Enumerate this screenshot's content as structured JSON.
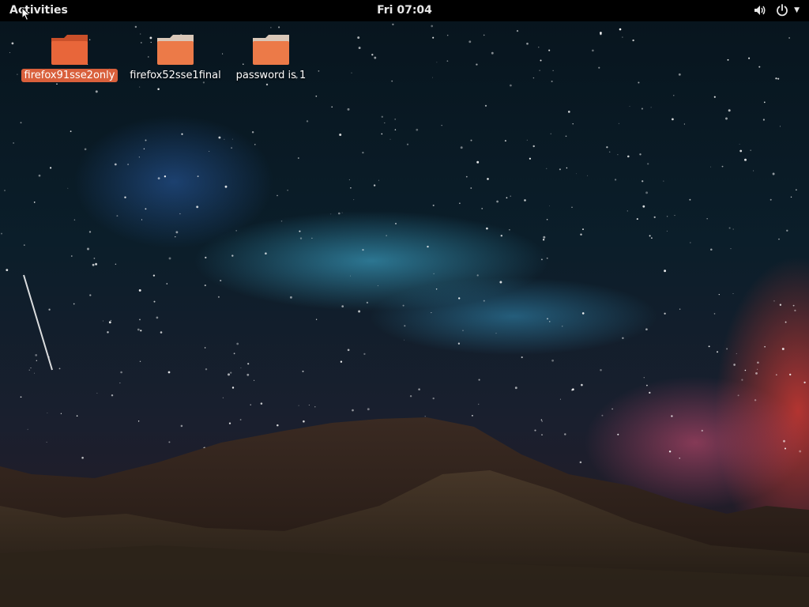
{
  "top_bar": {
    "activities_label": "Activities",
    "clock": "Fri 07:04",
    "tray": [
      {
        "icon": "volume-icon"
      },
      {
        "icon": "power-icon"
      },
      {
        "icon": "chevron-down-icon"
      }
    ]
  },
  "desktop": {
    "icons": [
      {
        "label": "firefox91sse2only",
        "icon": "folder-icon",
        "selected": true
      },
      {
        "label": "firefox52sse1final",
        "icon": "folder-icon",
        "selected": false
      },
      {
        "label": "password is 1",
        "icon": "folder-icon",
        "selected": false
      }
    ]
  },
  "colors": {
    "top_bar_bg": "#000000",
    "folder_orange": "#e8663a",
    "selection_highlight": "#d9603c"
  }
}
